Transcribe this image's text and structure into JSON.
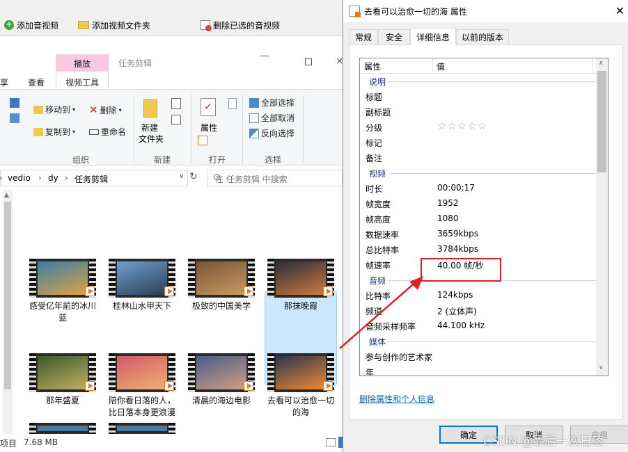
{
  "toolbar": {
    "add_media": "添加音视频",
    "add_folder": "添加视频文件夹",
    "delete_selected": "删除已选的音视频"
  },
  "explorer": {
    "tabs": {
      "play_context": "播放",
      "task_title": "任务剪辑",
      "share_partial": "享",
      "view": "查看",
      "video_tools": "视频工具"
    },
    "ribbon": {
      "move_to": "移动到",
      "copy_to": "复制到",
      "delete": "删除",
      "rename": "重命名",
      "new_folder_line1": "新建",
      "new_folder_line2": "文件夹",
      "properties": "属性",
      "select_all": "全部选择",
      "select_none": "全部取消",
      "invert_selection": "反向选择",
      "group_organize": "组织",
      "group_new": "新建",
      "group_open": "打开",
      "group_select": "选择"
    },
    "address": {
      "crumbs": [
        "vedio",
        "dy",
        "任务剪辑"
      ],
      "search_placeholder": "在 任务剪辑 中搜索"
    },
    "files": [
      {
        "name": "感受亿年前的冰川蓝",
        "color1": "#3a7fa8",
        "color2": "#e0a040"
      },
      {
        "name": "桂林山水甲天下",
        "color1": "#6fa0d0",
        "color2": "#2b3e55"
      },
      {
        "name": "极致的中国美学",
        "color1": "#7a5535",
        "color2": "#c99a60"
      },
      {
        "name": "那抹晚霞",
        "color1": "#2a2d3a",
        "color2": "#d07a40"
      },
      {
        "name": "那年盛夏",
        "color1": "#3c5a2a",
        "color2": "#c0b060"
      },
      {
        "name": "陪你看日落的人，比日落本身更浪漫",
        "color1": "#d05a6a",
        "color2": "#f0b070"
      },
      {
        "name": "清晨的海边电影",
        "color1": "#4a5b8a",
        "color2": "#d0a080"
      },
      {
        "name": "去看可以治愈一切的海",
        "color1": "#2a3550",
        "color2": "#f08a30"
      }
    ],
    "status": {
      "item_partial": "项目",
      "size": "7.68 MB"
    }
  },
  "dialog": {
    "title": "去看可以治愈一切的海 属性",
    "tabs": [
      "常规",
      "安全",
      "详细信息",
      "以前的版本"
    ],
    "active_tab": 2,
    "header": {
      "property": "属性",
      "value": "值"
    },
    "sections": {
      "description": "说明",
      "video": "视频",
      "audio": "音频",
      "media": "媒体"
    },
    "description_rows": [
      {
        "k": "标题",
        "v": ""
      },
      {
        "k": "副标题",
        "v": ""
      },
      {
        "k": "分级",
        "v": "☆☆☆☆☆"
      },
      {
        "k": "标记",
        "v": ""
      },
      {
        "k": "备注",
        "v": ""
      }
    ],
    "video_rows": [
      {
        "k": "时长",
        "v": "00:00:17"
      },
      {
        "k": "帧宽度",
        "v": "1952"
      },
      {
        "k": "帧高度",
        "v": "1080"
      },
      {
        "k": "数据速率",
        "v": "3659kbps"
      },
      {
        "k": "总比特率",
        "v": "3784kbps"
      },
      {
        "k": "帧速率",
        "v": "40.00 帧/秒"
      }
    ],
    "audio_rows": [
      {
        "k": "比特率",
        "v": "124kbps"
      },
      {
        "k": "频道",
        "v": "2 (立体声)"
      },
      {
        "k": "音频采样频率",
        "v": "44.100 kHz"
      }
    ],
    "media_rows": [
      {
        "k": "参与创作的艺术家",
        "v": ""
      },
      {
        "k": "年",
        "v": ""
      }
    ],
    "remove_link": "删除属性和个人信息",
    "ok": "确定",
    "cancel": "取消",
    "apply": "应用"
  },
  "colors": {
    "highlight_box": "#e02020",
    "arrow": "#e02020",
    "ribbon_play_tab": "#f9c9e0",
    "selected_item": "#cce8ff",
    "link": "#0066cc"
  },
  "watermark": "CSDN @最后一次日落"
}
